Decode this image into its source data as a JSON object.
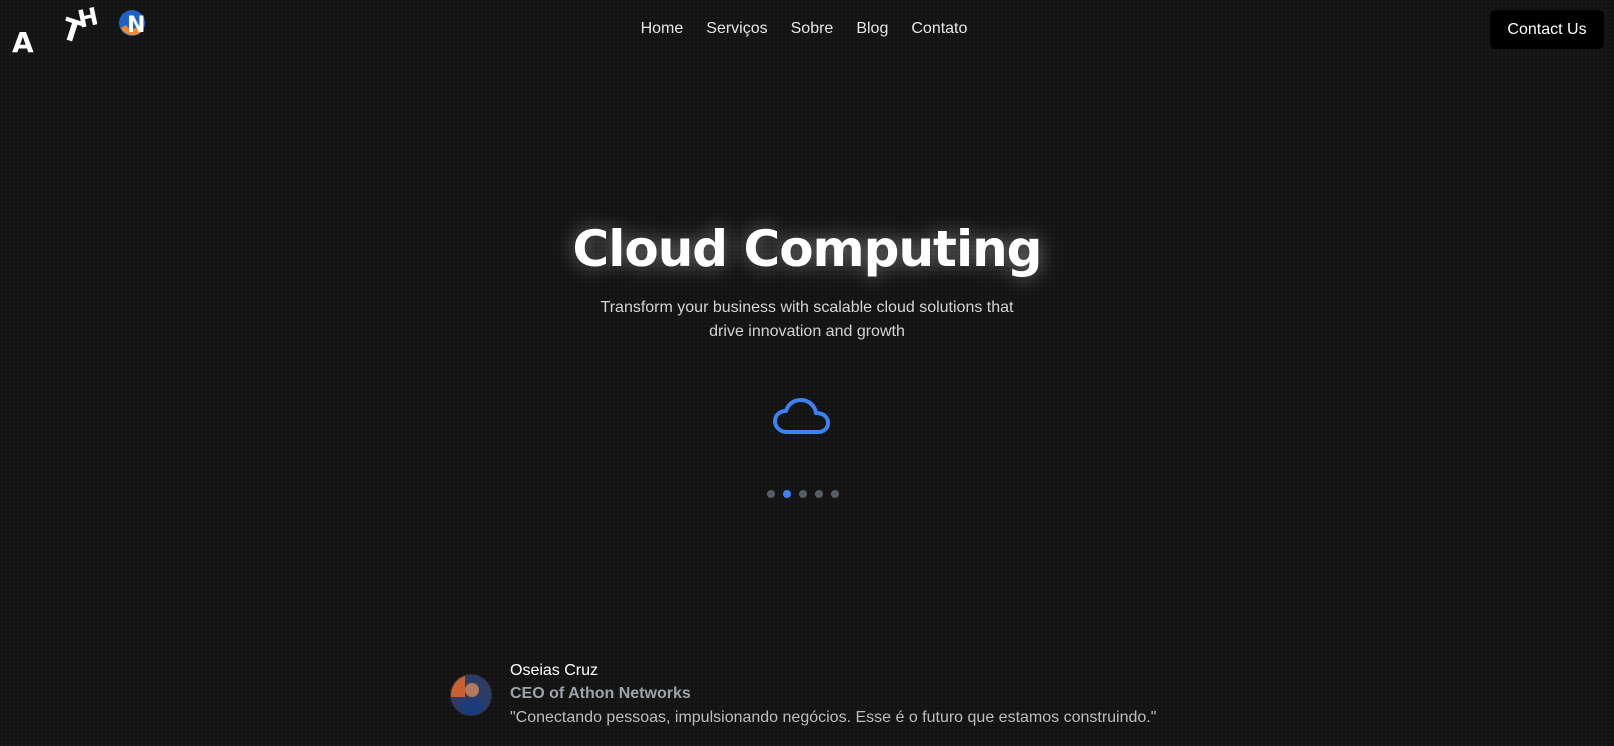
{
  "logo": {
    "letters": [
      "A",
      "T",
      "H",
      "O",
      "N"
    ],
    "icon": "athon-logo"
  },
  "nav": {
    "items": [
      {
        "label": "Home"
      },
      {
        "label": "Serviços"
      },
      {
        "label": "Sobre"
      },
      {
        "label": "Blog"
      },
      {
        "label": "Contato"
      }
    ]
  },
  "header": {
    "contact_label": "Contact Us"
  },
  "hero": {
    "title": "Cloud Computing",
    "subtitle": "Transform your business with scalable cloud solutions that drive innovation and growth",
    "icon": "cloud-icon",
    "icon_color": "#3b82f6"
  },
  "carousel": {
    "slide_count": 5,
    "active_index": 1,
    "active_color": "#3b82f6",
    "inactive_color": "#555c68"
  },
  "testimonial": {
    "name": "Oseias Cruz",
    "role": "CEO of Athon Networks",
    "quote": "\"Conectando pessoas, impulsionando negócios. Esse é o futuro que estamos construindo.\""
  },
  "colors": {
    "background": "#131313",
    "accent": "#3b82f6"
  }
}
